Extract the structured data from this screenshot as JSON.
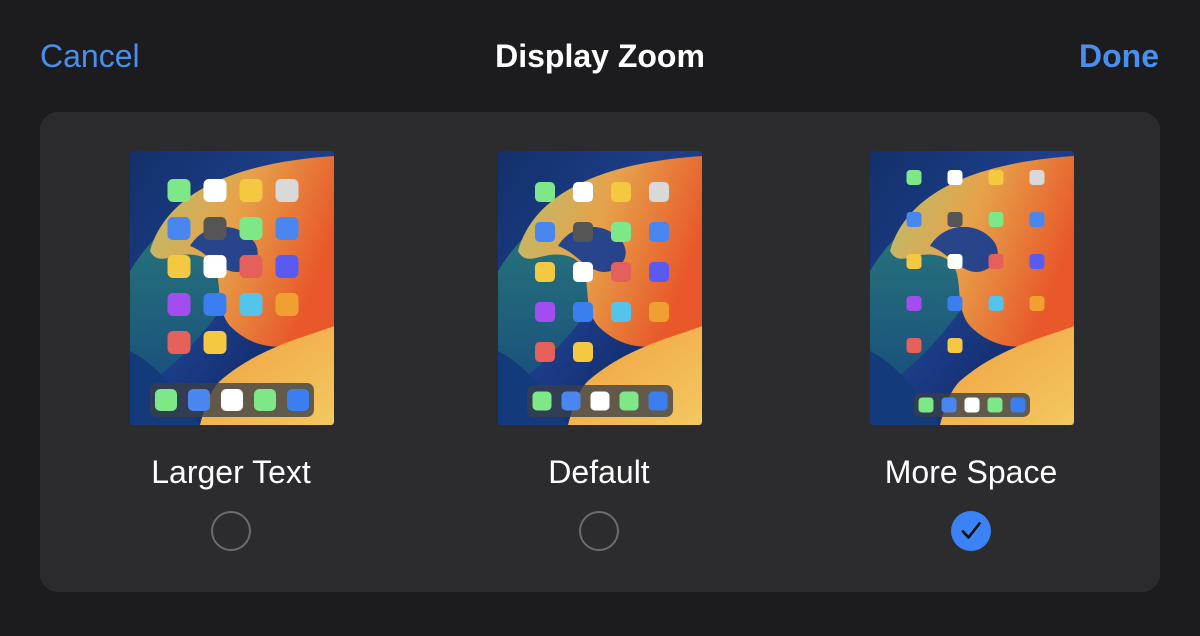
{
  "nav": {
    "cancel_label": "Cancel",
    "title": "Display Zoom",
    "done_label": "Done"
  },
  "options": [
    {
      "label": "Larger Text",
      "selected": false
    },
    {
      "label": "Default",
      "selected": false
    },
    {
      "label": "More Space",
      "selected": true
    }
  ],
  "colors": {
    "accent": "#3b82f6",
    "sheet_background": "#1c1c1e",
    "panel_background": "#2c2c2e",
    "radio_outline": "#6b6b70"
  },
  "icons": {
    "checkmark": "checkmark-icon"
  }
}
